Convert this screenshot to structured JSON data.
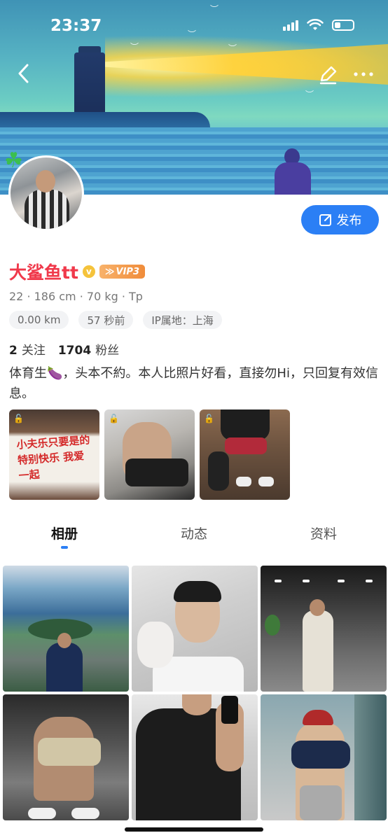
{
  "status_bar": {
    "time": "23:37"
  },
  "header": {
    "back_icon": "chevron-left-icon",
    "edit_icon": "pencil-icon",
    "more_icon": "ellipsis-icon"
  },
  "profile": {
    "name": "大鲨鱼tt",
    "vip_label": "VIP3",
    "stats_line": "22 · 186 cm · 70 kg · Tp",
    "chips": [
      "0.00 km",
      "57 秒前",
      "IP属地：上海"
    ],
    "following_count": "2",
    "following_label": "关注",
    "followers_count": "1704",
    "followers_label": "粉丝",
    "bio": "体育生🍆，头本不約。本人比照片好看，直接勿Hi，只回复有效信息。",
    "publish_button": "发布",
    "highlight_banner_text": "小夫乐只要是的 特别快乐 我爱一起"
  },
  "tabs": [
    "相册",
    "动态",
    "资料"
  ],
  "active_tab": 0,
  "colors": {
    "accent": "#2b7ff5",
    "name_color": "#f0394b",
    "vip": "#f08c3a",
    "verified": "#f5c33b",
    "clover": "#3bbf4e"
  }
}
